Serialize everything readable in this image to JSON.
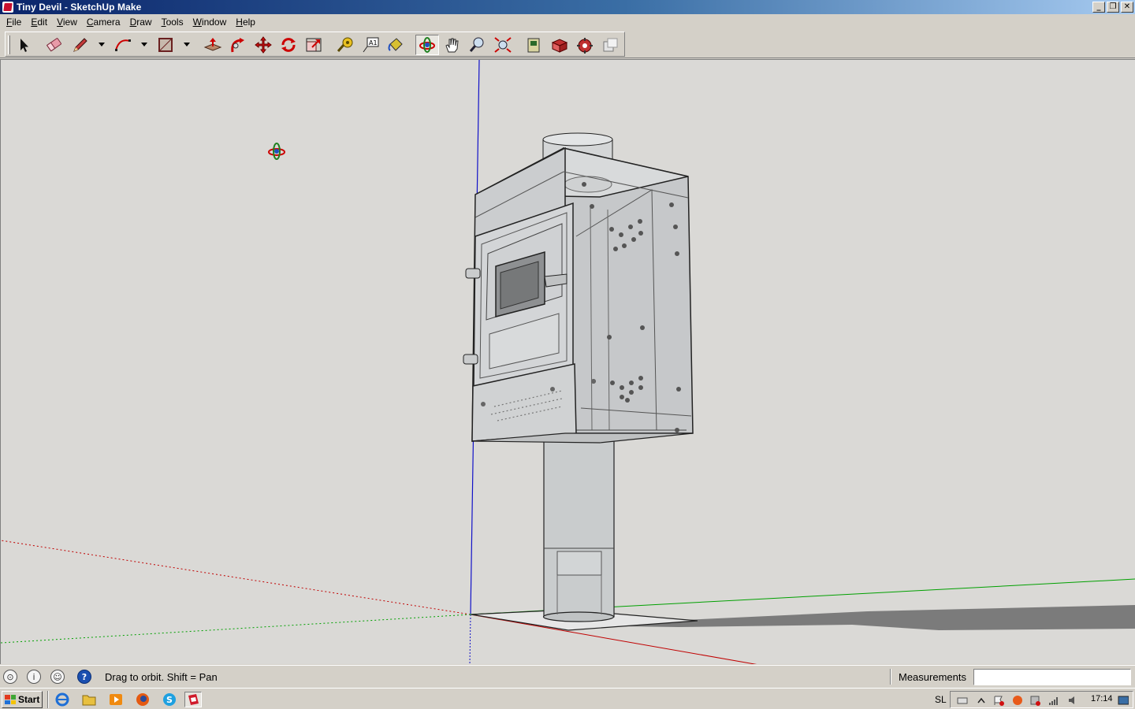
{
  "window": {
    "title": "Tiny Devil - SketchUp Make",
    "buttons": [
      "minimize",
      "restore",
      "close"
    ]
  },
  "menu": [
    {
      "label": "File",
      "accel": "F"
    },
    {
      "label": "Edit",
      "accel": "E"
    },
    {
      "label": "View",
      "accel": "V"
    },
    {
      "label": "Camera",
      "accel": "C"
    },
    {
      "label": "Draw",
      "accel": "D"
    },
    {
      "label": "Tools",
      "accel": "T"
    },
    {
      "label": "Window",
      "accel": "W"
    },
    {
      "label": "Help",
      "accel": "H"
    }
  ],
  "toolbar": {
    "tools": [
      "select",
      "eraser",
      "line",
      "arc",
      "rectangle",
      "push-pull",
      "follow-me",
      "move",
      "rotate",
      "scale",
      "tape-measure",
      "text",
      "paint-bucket",
      "orbit",
      "pan",
      "zoom",
      "zoom-extents",
      "3d-warehouse",
      "share-model",
      "get-models",
      "extension-warehouse"
    ],
    "active_tool": "orbit"
  },
  "viewport": {
    "background": "#dad9d6",
    "axis_colors": {
      "red": "#c00000",
      "green": "#00a000",
      "blue": "#0000c0"
    },
    "model_name": "Tiny Devil"
  },
  "status": {
    "hint": "Drag to orbit.  Shift = Pan",
    "measurements_label": "Measurements",
    "measurements_value": ""
  },
  "taskbar": {
    "start_label": "Start",
    "quick_launch": [
      "internet-explorer",
      "file-explorer",
      "media-player",
      "firefox",
      "skype",
      "sketchup"
    ],
    "active_app": "sketchup",
    "language": "SL",
    "clock": "17:14"
  }
}
